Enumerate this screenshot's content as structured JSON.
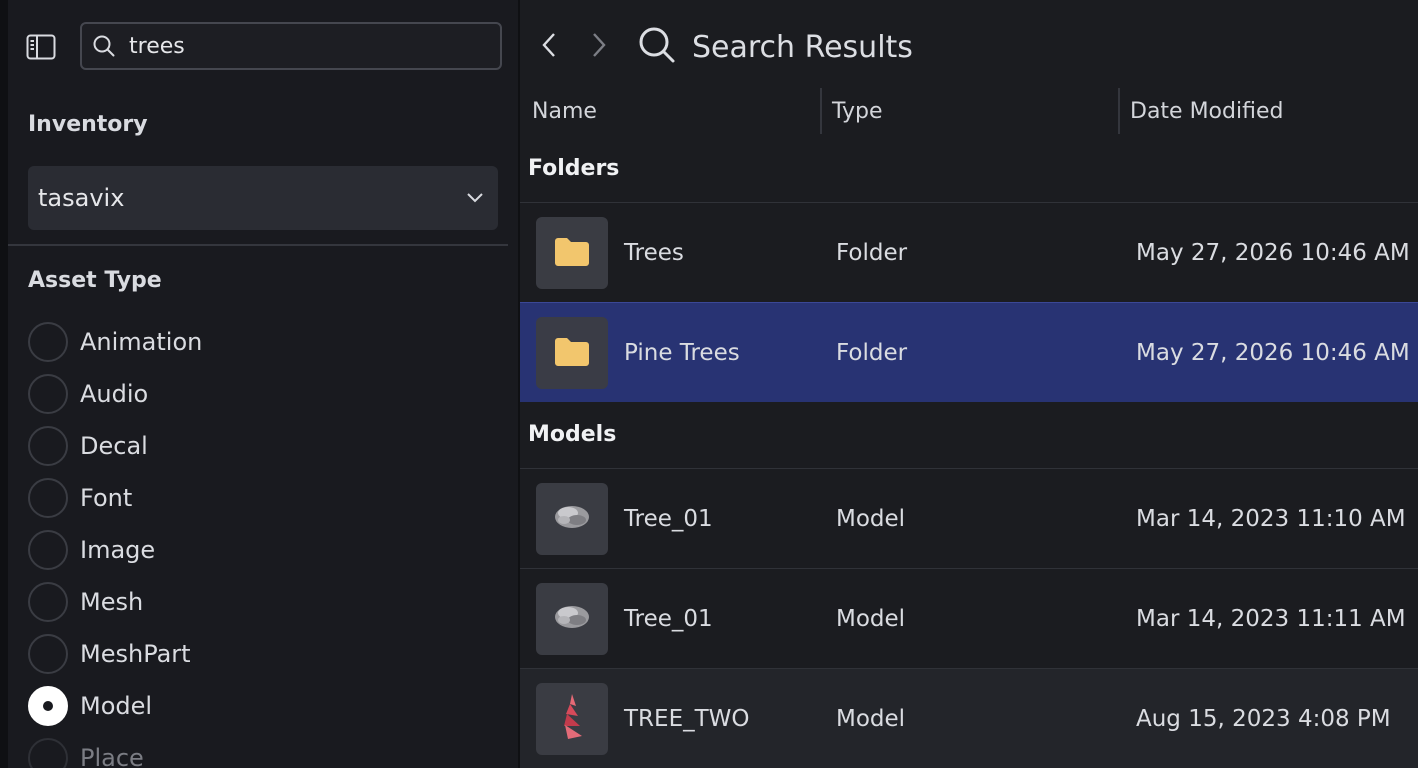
{
  "sidebar": {
    "search": {
      "value": "trees",
      "placeholder": ""
    },
    "inventory_label": "Inventory",
    "inventory_selected": "tasavix",
    "asset_type_label": "Asset Type",
    "asset_types": [
      {
        "label": "Animation",
        "checked": false
      },
      {
        "label": "Audio",
        "checked": false
      },
      {
        "label": "Decal",
        "checked": false
      },
      {
        "label": "Font",
        "checked": false
      },
      {
        "label": "Image",
        "checked": false
      },
      {
        "label": "Mesh",
        "checked": false
      },
      {
        "label": "MeshPart",
        "checked": false
      },
      {
        "label": "Model",
        "checked": true
      },
      {
        "label": "Place",
        "checked": false
      }
    ]
  },
  "main": {
    "title": "Search Results",
    "columns": {
      "name": "Name",
      "type": "Type",
      "date": "Date Modified"
    },
    "groups": {
      "folders": "Folders",
      "models": "Models"
    },
    "folder_rows": [
      {
        "name": "Trees",
        "type": "Folder",
        "date": "May 27, 2026 10:46 AM",
        "selected": false
      },
      {
        "name": "Pine Trees",
        "type": "Folder",
        "date": "May 27, 2026 10:46 AM",
        "selected": true
      }
    ],
    "model_rows": [
      {
        "name": "Tree_01",
        "type": "Model",
        "date": "Mar 14, 2023 11:10 AM",
        "thumb": "gray-tree-model-icon"
      },
      {
        "name": "Tree_01",
        "type": "Model",
        "date": "Mar 14, 2023 11:11 AM",
        "thumb": "gray-tree-model-icon"
      },
      {
        "name": "TREE_TWO",
        "type": "Model",
        "date": "Aug 15, 2023 4:08 PM",
        "thumb": "red-pine-model-icon"
      }
    ]
  },
  "colors": {
    "selected_row": "#283373",
    "folder_icon": "#f2c66d",
    "red_model": "#d64a5a"
  }
}
